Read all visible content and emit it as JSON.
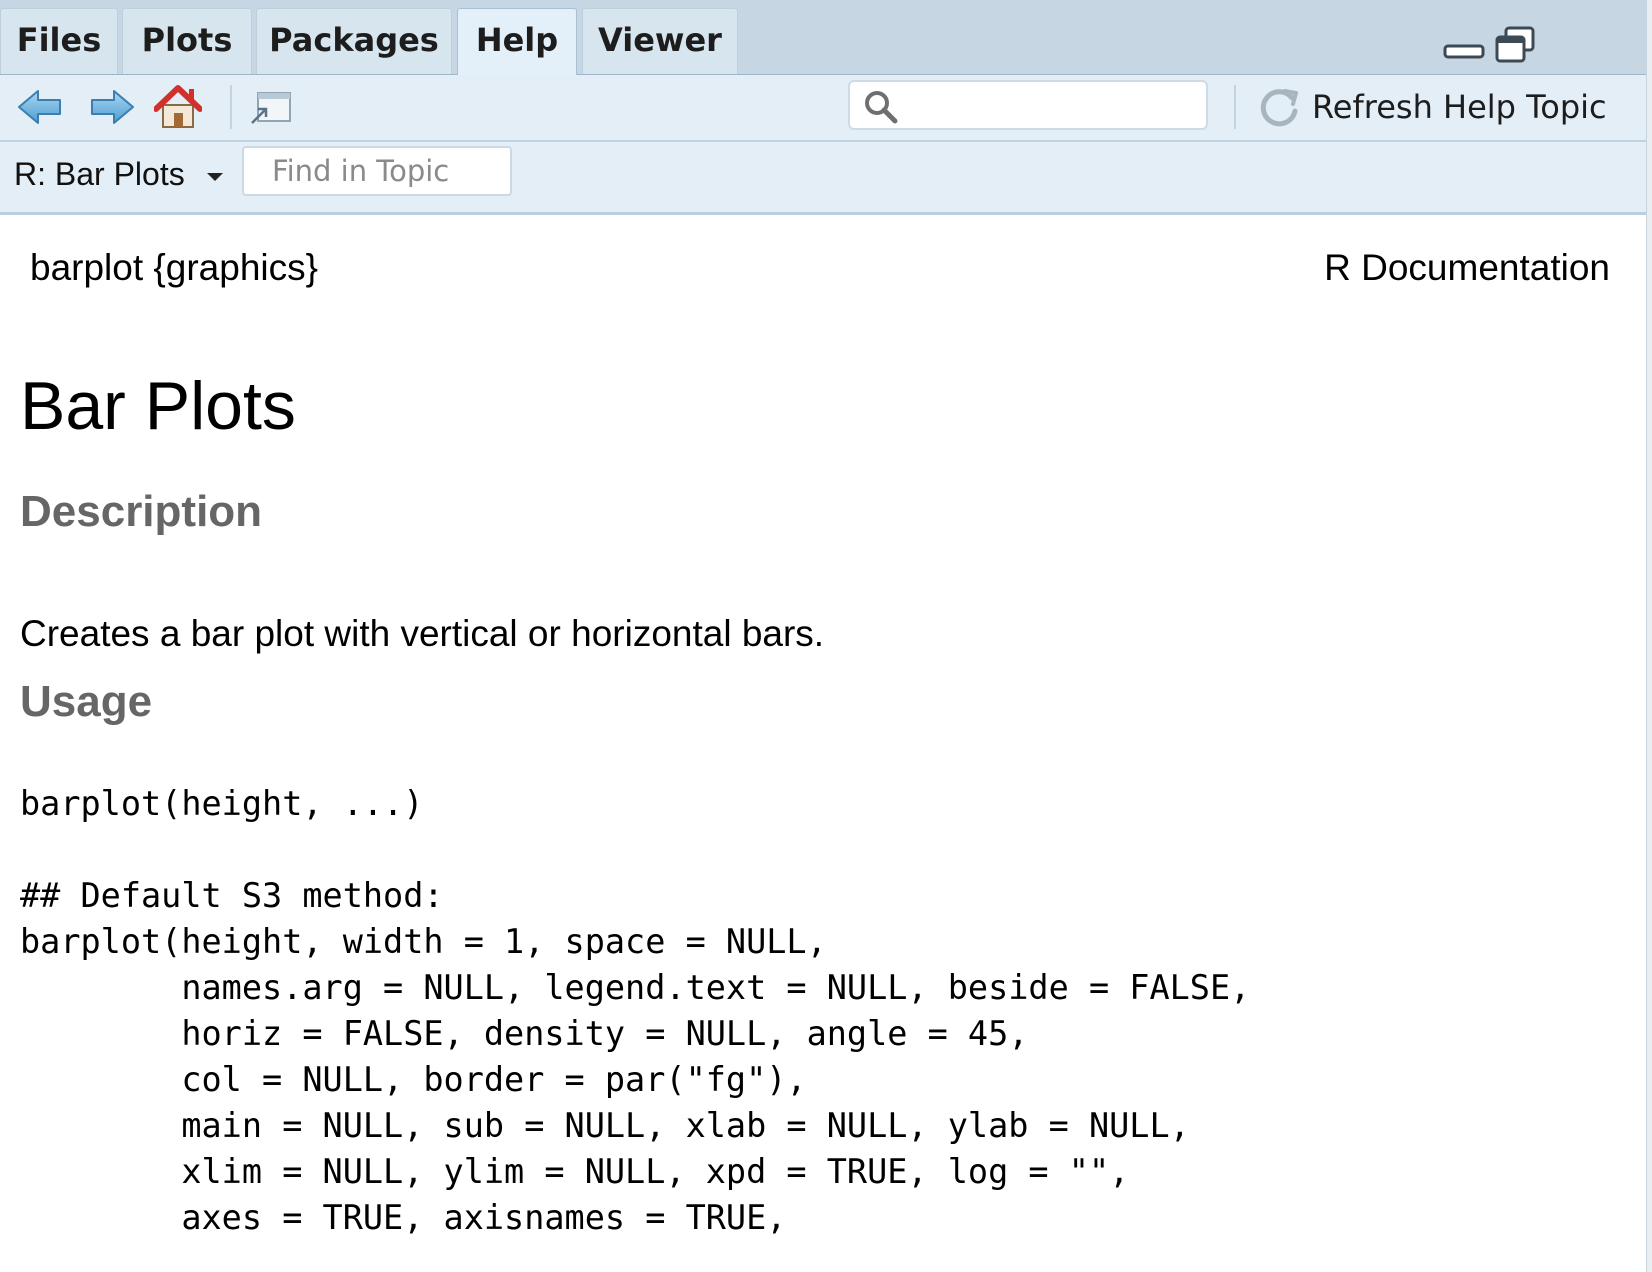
{
  "tabs": [
    {
      "label": "Files",
      "active": false
    },
    {
      "label": "Plots",
      "active": false
    },
    {
      "label": "Packages",
      "active": false
    },
    {
      "label": "Help",
      "active": true
    },
    {
      "label": "Viewer",
      "active": false
    }
  ],
  "toolbar": {
    "back_icon": "arrow-left-icon",
    "forward_icon": "arrow-right-icon",
    "home_icon": "home-icon",
    "popout_icon": "popout-window-icon",
    "search_icon": "search-icon",
    "search_value": "",
    "refresh_label": "Refresh Help Topic"
  },
  "topicbar": {
    "topic_label": "R: Bar Plots",
    "find_placeholder": "Find in Topic"
  },
  "doc": {
    "name": "barplot {graphics}",
    "source": "R Documentation",
    "title": "Bar Plots",
    "description_heading": "Description",
    "description_text": "Creates a bar plot with vertical or horizontal bars.",
    "usage_heading": "Usage",
    "usage_code": [
      "barplot(height, ...)",
      "",
      "## Default S3 method:",
      "barplot(height, width = 1, space = NULL,",
      "        names.arg = NULL, legend.text = NULL, beside = FALSE,",
      "        horiz = FALSE, density = NULL, angle = 45,",
      "        col = NULL, border = par(\"fg\"),",
      "        main = NULL, sub = NULL, xlab = NULL, ylab = NULL,",
      "        xlim = NULL, ylim = NULL, xpd = TRUE, log = \"\",",
      "        axes = TRUE, axisnames = TRUE,"
    ]
  },
  "colors": {
    "tabbar_bg": "#c6d7e3",
    "toolbar_bg": "#e3eef6",
    "heading_gray": "#666666",
    "home_roof": "#d0312d"
  }
}
